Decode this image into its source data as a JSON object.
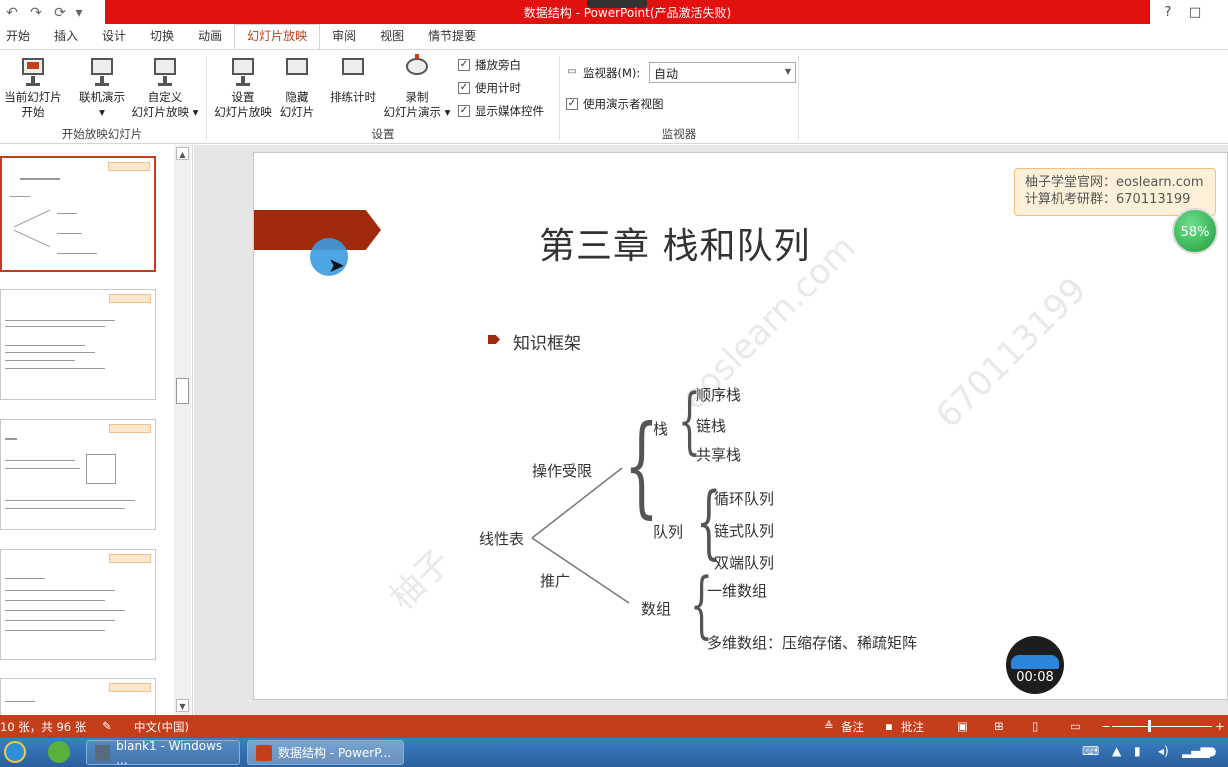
{
  "window": {
    "title": "数据结构 - PowerPoint(产品激活失败)",
    "help": "?",
    "restore": "□"
  },
  "qat": {
    "undo": "↶",
    "redo": "↷",
    "custom": "⟳",
    "more": "▾"
  },
  "tabs": [
    "开始",
    "插入",
    "设计",
    "切换",
    "动画",
    "幻灯片放映",
    "审阅",
    "视图",
    "情节提要"
  ],
  "active_tab": "幻灯片放映",
  "ribbon": {
    "from_current": "从当前幻灯片\n开始",
    "from_current_l1": "当前幻灯片",
    "from_current_l2": "开始",
    "online": "联机演示",
    "online_arrow": "▾",
    "custom_l1": "自定义",
    "custom_l2": "幻灯片放映 ▾",
    "group_start": "开始放映幻灯片",
    "setup_l1": "设置",
    "setup_l2": "幻灯片放映",
    "hide_l1": "隐藏",
    "hide_l2": "幻灯片",
    "rehearse": "排练计时",
    "record_l1": "录制",
    "record_l2": "幻灯片演示 ▾",
    "chk_narration": "播放旁白",
    "chk_timings": "使用计时",
    "chk_media": "显示媒体控件",
    "group_setup": "设置",
    "monitor_label": "监视器(M):",
    "monitor_value": "自动",
    "chk_presenter": "使用演示者视图",
    "group_monitor": "监视器",
    "check_mark": "✓"
  },
  "slide": {
    "title": "第三章 栈和队列",
    "bullet": "知识框架",
    "promo_line1": "柚子学堂官网：eoslearn.com",
    "promo_line2": "计算机考研群：670113199",
    "watermark1": "eoslearn.com",
    "watermark2": "670113199",
    "watermark3": "柚子",
    "tree": {
      "root": "线性表",
      "branch_a": "操作受限",
      "branch_b": "推广",
      "stack": "栈",
      "stack_items": [
        "顺序栈",
        "链栈",
        "共享栈"
      ],
      "queue": "队列",
      "queue_items": [
        "循环队列",
        "链式队列",
        "双端队列"
      ],
      "array": "数组",
      "array_items": [
        "一维数组",
        "多维数组：压缩存储、稀疏矩阵"
      ]
    }
  },
  "overlay": {
    "percent": "58%",
    "timer": "00:08"
  },
  "status": {
    "slide_count": "10 张，共 96 张",
    "language": "中文(中国)",
    "notes": "备注",
    "comments": "批注"
  },
  "taskbar": {
    "btn1": "blank1 - Windows ...",
    "btn2": "数据结构 - PowerP..."
  }
}
